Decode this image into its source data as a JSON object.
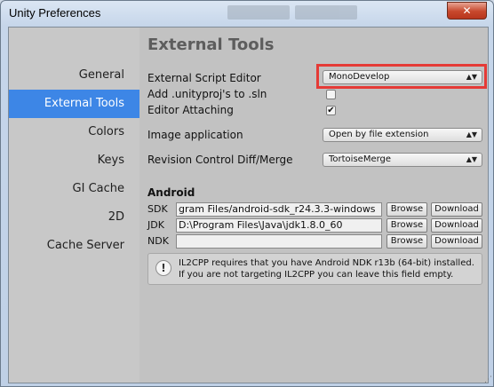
{
  "window": {
    "title": "Unity Preferences",
    "close_glyph": "✕"
  },
  "sidebar": {
    "items": [
      {
        "label": "General"
      },
      {
        "label": "External Tools",
        "active": true
      },
      {
        "label": "Colors"
      },
      {
        "label": "Keys"
      },
      {
        "label": "GI Cache"
      },
      {
        "label": "2D"
      },
      {
        "label": "Cache Server"
      }
    ]
  },
  "main": {
    "section_title": "External Tools",
    "external_script_editor": {
      "label": "External Script Editor",
      "value": "MonoDevelop"
    },
    "add_unityproj": {
      "label": "Add .unityproj's to .sln",
      "checked": false
    },
    "editor_attaching": {
      "label": "Editor Attaching",
      "checked": true
    },
    "image_application": {
      "label": "Image application",
      "value": "Open by file extension"
    },
    "revision_control": {
      "label": "Revision Control Diff/Merge",
      "value": "TortoiseMerge"
    },
    "checkmark_glyph": "✔",
    "dropdown_arrow_glyph": "▲▼"
  },
  "android": {
    "title": "Android",
    "rows": [
      {
        "label": "SDK",
        "value": "gram Files/android-sdk_r24.3.3-windows",
        "browse": "Browse",
        "download": "Download"
      },
      {
        "label": "JDK",
        "value": "D:\\Program Files\\Java\\jdk1.8.0_60",
        "browse": "Browse",
        "download": "Download"
      },
      {
        "label": "NDK",
        "value": "",
        "browse": "Browse",
        "download": "Download"
      }
    ],
    "help": {
      "icon": "!",
      "line1": "IL2CPP requires that you have Android NDK r13b (64-bit) installed.",
      "line2": "If you are not targeting IL2CPP you can leave this field empty."
    }
  },
  "colors": {
    "active_sidebar": "#3d86e6",
    "highlight_box": "#e53a36"
  }
}
